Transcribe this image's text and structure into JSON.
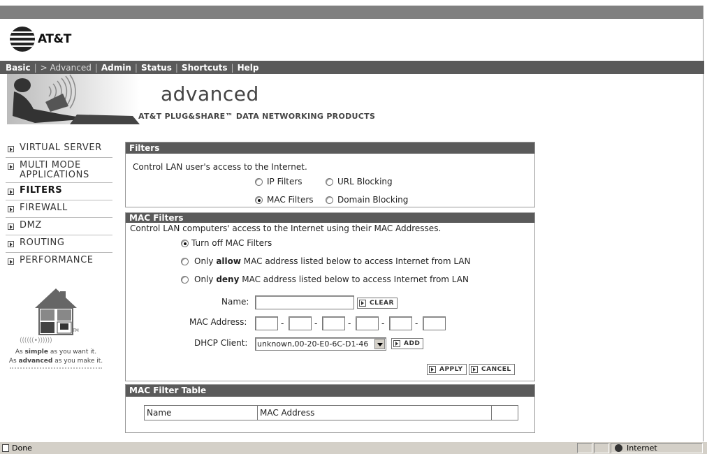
{
  "logo": {
    "brand": "AT&T"
  },
  "nav": {
    "items": [
      "Basic",
      "> Advanced",
      "Admin",
      "Status",
      "Shortcuts",
      "Help"
    ]
  },
  "banner": {
    "title": "advanced",
    "subtitle": "AT&T PLUG&SHARE™ DATA NETWORKING PRODUCTS"
  },
  "sidebar": {
    "items": [
      {
        "label": "VIRTUAL SERVER"
      },
      {
        "label": "MULTI MODE APPLICATIONS"
      },
      {
        "label": "FILTERS",
        "active": true
      },
      {
        "label": "FIREWALL"
      },
      {
        "label": "DMZ"
      },
      {
        "label": "ROUTING"
      },
      {
        "label": "PERFORMANCE"
      }
    ],
    "tm": "TM",
    "waves": "((((((•))))))",
    "tagline1_a": "As ",
    "tagline1_b": "simple",
    "tagline1_c": " as you want it.",
    "tagline2_a": "As ",
    "tagline2_b": "advanced",
    "tagline2_c": " as you make it."
  },
  "filters": {
    "heading": "Filters",
    "description": "Control LAN user's access to the Internet.",
    "options": {
      "ip": "IP Filters",
      "url": "URL Blocking",
      "mac": "MAC Filters",
      "domain": "Domain Blocking"
    },
    "selected": "mac"
  },
  "mac_filters": {
    "heading": "MAC Filters",
    "description": "Control LAN computers' access to the Internet using their MAC Addresses.",
    "modes": {
      "off": "Turn off MAC Filters",
      "allow_pre": "Only ",
      "allow_bold": "allow",
      "allow_post": " MAC address listed below to access Internet from LAN",
      "deny_pre": "Only ",
      "deny_bold": "deny",
      "deny_post": " MAC address listed below to access Internet from LAN"
    },
    "selected_mode": "off",
    "name_label": "Name:",
    "name_value": "",
    "clear_label": "CLEAR",
    "mac_label": "MAC Address:",
    "mac_sep": "-",
    "mac_octets": [
      "",
      "",
      "",
      "",
      "",
      ""
    ],
    "dhcp_label": "DHCP Client:",
    "dhcp_selected": "unknown,00-20-E0-6C-D1-46",
    "add_label": "ADD",
    "apply_label": "APPLY",
    "cancel_label": "CANCEL"
  },
  "mac_table": {
    "heading": "MAC Filter Table",
    "columns": [
      "Name",
      "MAC Address",
      ""
    ]
  },
  "statusbar": {
    "status": "Done",
    "zone": "Internet"
  }
}
